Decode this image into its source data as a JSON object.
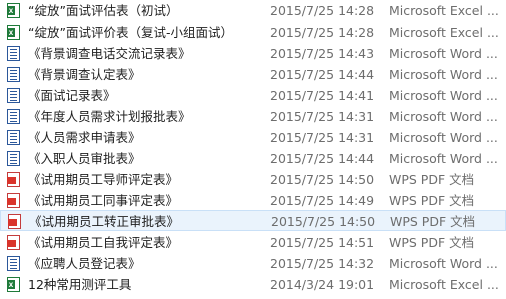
{
  "files": [
    {
      "name": "“绽放”面试评估表（初试）",
      "date": "2015/7/25 14:28",
      "type": "Microsoft Excel ...",
      "icon": "excel-file-icon"
    },
    {
      "name": "“绽放”面试评价表（复试-小组面试）",
      "date": "2015/7/25 14:28",
      "type": "Microsoft Excel ...",
      "icon": "excel-file-icon"
    },
    {
      "name": "《背景调查电话交流记录表》",
      "date": "2015/7/25 14:43",
      "type": "Microsoft Word ...",
      "icon": "word-file-icon"
    },
    {
      "name": "《背景调查认定表》",
      "date": "2015/7/25 14:44",
      "type": "Microsoft Word ...",
      "icon": "word-file-icon"
    },
    {
      "name": "《面试记录表》",
      "date": "2015/7/25 14:41",
      "type": "Microsoft Word ...",
      "icon": "word-file-icon"
    },
    {
      "name": "《年度人员需求计划报批表》",
      "date": "2015/7/25 14:31",
      "type": "Microsoft Word ...",
      "icon": "word-file-icon"
    },
    {
      "name": "《人员需求申请表》",
      "date": "2015/7/25 14:31",
      "type": "Microsoft Word ...",
      "icon": "word-file-icon"
    },
    {
      "name": "《入职人员审批表》",
      "date": "2015/7/25 14:44",
      "type": "Microsoft Word ...",
      "icon": "word-file-icon"
    },
    {
      "name": "《试用期员工导师评定表》",
      "date": "2015/7/25 14:50",
      "type": "WPS PDF 文档",
      "icon": "pdf-file-icon"
    },
    {
      "name": "《试用期员工同事评定表》",
      "date": "2015/7/25 14:49",
      "type": "WPS PDF 文档",
      "icon": "pdf-file-icon"
    },
    {
      "name": "《试用期员工转正审批表》",
      "date": "2015/7/25 14:50",
      "type": "WPS PDF 文档",
      "icon": "pdf-file-icon"
    },
    {
      "name": "《试用期员工自我评定表》",
      "date": "2015/7/25 14:51",
      "type": "WPS PDF 文档",
      "icon": "pdf-file-icon"
    },
    {
      "name": "《应聘人员登记表》",
      "date": "2015/7/25 14:32",
      "type": "Microsoft Word ...",
      "icon": "word-file-icon"
    },
    {
      "name": "12种常用测评工具",
      "date": "2014/3/24 19:01",
      "type": "Microsoft Excel ...",
      "icon": "excel-file-icon"
    }
  ]
}
